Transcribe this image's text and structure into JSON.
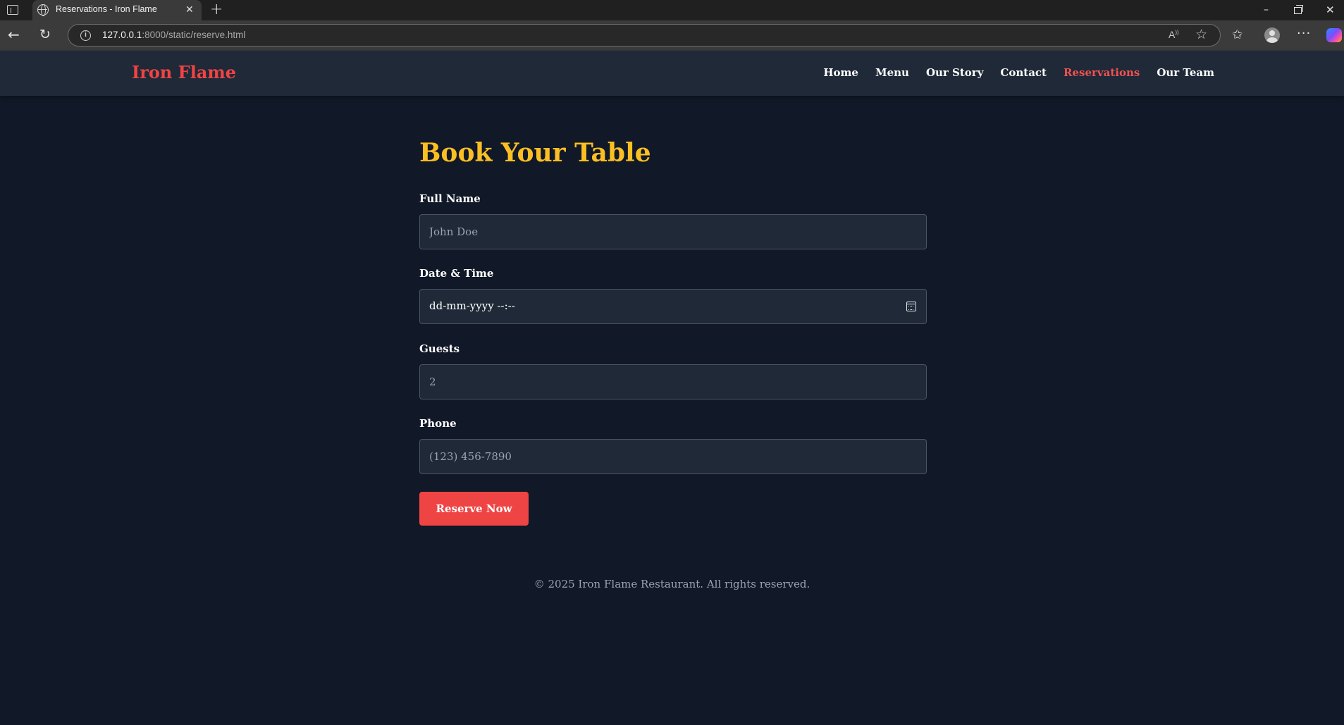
{
  "browser": {
    "tab_title": "Reservations - Iron Flame",
    "url_host": "127.0.0.1",
    "url_rest": ":8000/static/reserve.html",
    "icons": [
      "tab-strip-icon",
      "globe-icon",
      "close-icon",
      "plus-icon",
      "back-icon",
      "reload-icon",
      "info-icon",
      "read-aloud-icon",
      "star-icon",
      "favorites-icon",
      "profile-icon",
      "more-icon",
      "copilot-icon",
      "minimize-icon",
      "maximize-icon",
      "window-close-icon"
    ]
  },
  "header": {
    "logo": "Iron Flame",
    "nav": [
      {
        "label": "Home",
        "active": false
      },
      {
        "label": "Menu",
        "active": false
      },
      {
        "label": "Our Story",
        "active": false
      },
      {
        "label": "Contact",
        "active": false
      },
      {
        "label": "Reservations",
        "active": true
      },
      {
        "label": "Our Team",
        "active": false
      }
    ]
  },
  "form": {
    "title": "Book Your Table",
    "full_name": {
      "label": "Full Name",
      "placeholder": "John Doe",
      "value": ""
    },
    "datetime": {
      "label": "Date & Time",
      "value": "dd-mm-yyyy --:--"
    },
    "guests": {
      "label": "Guests",
      "placeholder": "2",
      "value": ""
    },
    "phone": {
      "label": "Phone",
      "placeholder": "(123) 456-7890",
      "value": ""
    },
    "submit_label": "Reserve Now"
  },
  "footer": {
    "text": "© 2025 Iron Flame Restaurant. All rights reserved."
  },
  "colors": {
    "page_bg": "#111827",
    "header_bg": "#1f2937",
    "logo": "#ef4444",
    "title": "#fbbf24",
    "active_nav": "#f05252",
    "button": "#ef4444"
  }
}
